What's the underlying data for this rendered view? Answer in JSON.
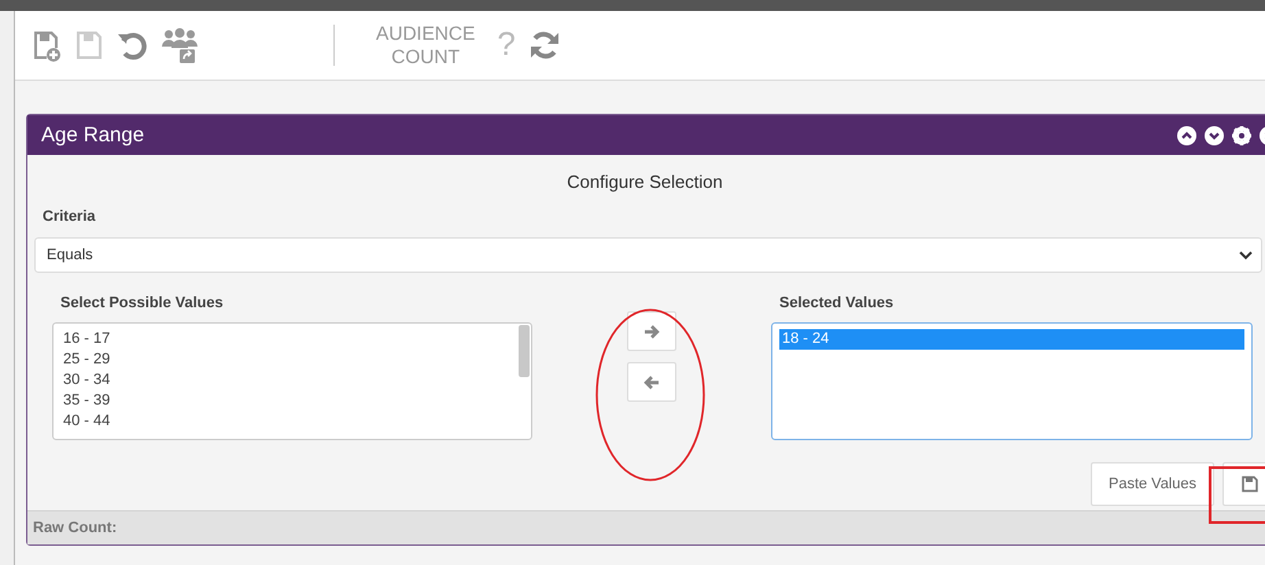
{
  "toolbar": {
    "audience_count": [
      "AUDIENCE",
      "COUNT"
    ],
    "help": "?"
  },
  "panel": {
    "title": "Age Range",
    "heading": "Configure Selection",
    "criteria": {
      "label": "Criteria",
      "value": "Equals"
    },
    "possible": {
      "label": "Select Possible Values",
      "items": [
        {
          "text": "16 - 17",
          "selected": false
        },
        {
          "text": "25 - 29",
          "selected": false
        },
        {
          "text": "30 - 34",
          "selected": false
        },
        {
          "text": "35 - 39",
          "selected": false
        },
        {
          "text": "40 - 44",
          "selected": false
        }
      ]
    },
    "chosen": {
      "label": "Selected Values",
      "items": [
        {
          "text": "18 - 24",
          "selected": true
        }
      ]
    },
    "paste_button": "Paste Values",
    "raw_count": "Raw Count:"
  }
}
